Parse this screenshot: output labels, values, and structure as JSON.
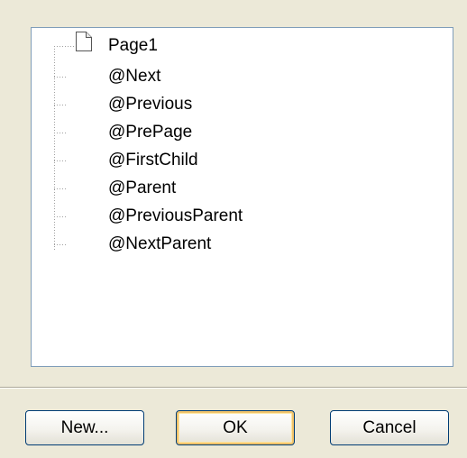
{
  "tree": {
    "root": {
      "label": "Page1",
      "icon": "page-icon"
    },
    "children": [
      {
        "label": "@Next"
      },
      {
        "label": "@Previous"
      },
      {
        "label": "@PrePage"
      },
      {
        "label": "@FirstChild"
      },
      {
        "label": "@Parent"
      },
      {
        "label": "@PreviousParent"
      },
      {
        "label": "@NextParent"
      }
    ]
  },
  "buttons": {
    "new_label": "New...",
    "ok_label": "OK",
    "cancel_label": "Cancel"
  },
  "colors": {
    "background": "#ece9d8",
    "tree_border": "#7f9db9",
    "button_border": "#003c74",
    "default_button_focus": "#f0c26a"
  }
}
